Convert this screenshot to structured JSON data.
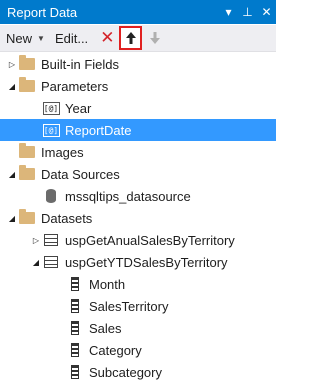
{
  "window": {
    "title": "Report Data",
    "controls": [
      "▾",
      "⊥",
      "✕"
    ]
  },
  "toolbar": {
    "new_label": "New",
    "edit_label": "Edit...",
    "delete_icon": "✕",
    "move_up_icon": "⬆",
    "move_down_icon": "⬇"
  },
  "tree": {
    "items": [
      {
        "label": "Built-in Fields",
        "expander": "▷"
      },
      {
        "label": "Parameters",
        "expander": "◢"
      },
      {
        "label": "Year",
        "icon_text": "[@]"
      },
      {
        "label": "ReportDate",
        "icon_text": "[@]",
        "selected": true
      },
      {
        "label": "Images"
      },
      {
        "label": "Data Sources",
        "expander": "◢"
      },
      {
        "label": "mssqltips_datasource"
      },
      {
        "label": "Datasets",
        "expander": "◢"
      },
      {
        "label": "uspGetAnualSalesByTerritory",
        "expander": "▷"
      },
      {
        "label": "uspGetYTDSalesByTerritory",
        "expander": "◢"
      },
      {
        "label": "Month"
      },
      {
        "label": "SalesTerritory"
      },
      {
        "label": "Sales"
      },
      {
        "label": "Category"
      },
      {
        "label": "Subcategory"
      }
    ]
  },
  "colors": {
    "title_bar": "#007acc",
    "selection": "#3399ff",
    "highlight_border": "#e02020",
    "delete": "#d4242b"
  }
}
